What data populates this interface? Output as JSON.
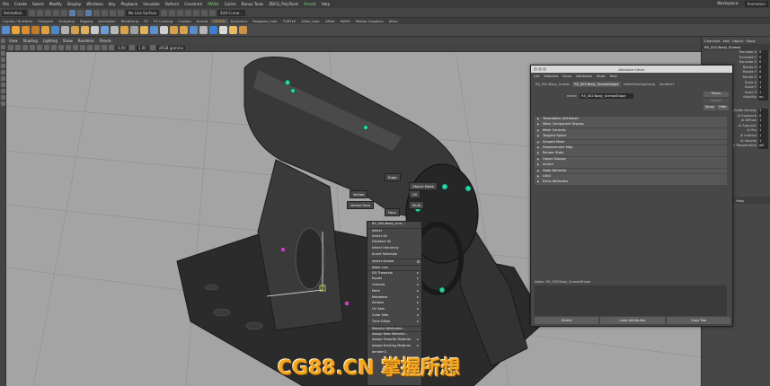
{
  "menubar": {
    "items": [
      "File",
      "Create",
      "Select",
      "Modify",
      "Display",
      "Windows",
      "Key",
      "Playback",
      "Visualize",
      "Deform",
      "Constrain",
      "MASH",
      "Cache",
      "Bonus Tools",
      "ZBCG_PolyTools",
      "Arnold",
      "Help"
    ],
    "workspace_label": "Workspace:",
    "workspace_value": "Animation"
  },
  "statusline": {
    "mode": "Animation",
    "no_live_surface": "No Live Surface",
    "edit_mode": "Edit Curve..."
  },
  "shelf": {
    "tabs": [
      "Curves / Surfaces",
      "Polygons",
      "Sculpting",
      "Rigging",
      "Animation",
      "Rendering",
      "FX",
      "FX Caching",
      "Custom",
      "Arnold",
      "GESDN",
      "Dynamics",
      "Polygons_User",
      "TURTLE",
      "XGen_User",
      "XMod",
      "MASH",
      "Motion Graphics",
      "XGen"
    ],
    "active_tab": "GESDN"
  },
  "viewport": {
    "menu": [
      "View",
      "Shading",
      "Lighting",
      "Show",
      "Renderer",
      "Panels"
    ],
    "field_a": "0.00",
    "field_b": "1.00",
    "colorspace": "sRGB gamma"
  },
  "marking_menu": {
    "north": "Edge",
    "northeast": "Object Mode",
    "west": "Vertex",
    "east": "UV",
    "southwest": "Vertex Face",
    "southeast": "Multi",
    "south": "Face"
  },
  "context_menu": {
    "header": "RS_002:Body_Scre...",
    "items": [
      {
        "label": "Select",
        "sep": true
      },
      {
        "label": "Select All",
        "sep": false
      },
      {
        "label": "Deselect All",
        "sep": false
      },
      {
        "label": "Select Hierarchy",
        "sep": false
      },
      {
        "label": "Invert Selection",
        "sep": false
      },
      {
        "label": "Select Similar",
        "sep": true,
        "box": true
      },
      {
        "label": "Make Live",
        "sep": true
      },
      {
        "label": "DG Traversal",
        "sep": true,
        "arrow": true
      },
      {
        "label": "Inputs",
        "sep": false,
        "arrow": true
      },
      {
        "label": "Outputs",
        "sep": false,
        "arrow": true
      },
      {
        "label": "Paint",
        "sep": false,
        "arrow": true
      },
      {
        "label": "Metadata",
        "sep": false,
        "arrow": true
      },
      {
        "label": "Actions",
        "sep": false,
        "arrow": true
      },
      {
        "label": "UV Sets",
        "sep": false,
        "arrow": true
      },
      {
        "label": "Color Sets",
        "sep": false,
        "arrow": true
      },
      {
        "label": "Time Editor",
        "sep": false,
        "arrow": true
      },
      {
        "label": "Material Attributes...",
        "sep": true
      },
      {
        "label": "Assign New Material...",
        "sep": true
      },
      {
        "label": "Assign Favorite Material",
        "sep": false,
        "arrow": true
      },
      {
        "label": "Assign Existing Material",
        "sep": false,
        "arrow": true
      },
      {
        "label": "lambert1",
        "sep": false
      }
    ]
  },
  "channel_box": {
    "menu": [
      "Channels",
      "Edit",
      "Object",
      "Show"
    ],
    "object_name": "RS_002:Body_Screws",
    "attributes": [
      {
        "name": "Translate X",
        "value": "0"
      },
      {
        "name": "Translate Y",
        "value": "0"
      },
      {
        "name": "Translate Z",
        "value": "0"
      },
      {
        "name": "Rotate X",
        "value": "0"
      },
      {
        "name": "Rotate Y",
        "value": "0"
      },
      {
        "name": "Rotate Z",
        "value": "0"
      },
      {
        "name": "Scale X",
        "value": "1"
      },
      {
        "name": "Scale Y",
        "value": "1"
      },
      {
        "name": "Scale Z",
        "value": "1"
      },
      {
        "name": "Visibility",
        "value": "on"
      }
    ],
    "shape_section": "...ScrewsShape",
    "shape_attributes": [
      {
        "name": "Visible Density",
        "value": "1"
      },
      {
        "name": "Ai Exposure",
        "value": "0"
      },
      {
        "name": "Ai Diffuse",
        "value": "1"
      },
      {
        "name": "Ai Specular",
        "value": "1"
      },
      {
        "name": "Ai Sss",
        "value": "1"
      },
      {
        "name": "Ai Indirect",
        "value": "1"
      },
      {
        "name": "Ai Volume",
        "value": "1"
      },
      {
        "name": "Ai Temperature",
        "value": "off"
      }
    ],
    "lower_menu": [
      "Layers",
      "Options",
      "Help"
    ]
  },
  "attribute_editor": {
    "title": "Attribute Editor",
    "menu": [
      "List",
      "Selected",
      "Focus",
      "Attributes",
      "Show",
      "Help"
    ],
    "tabs": [
      "RS_002:Body_Screws",
      "RS_002:Body_ScrewsShape",
      "initialShadingGroup",
      "lambert1"
    ],
    "active_tab": "RS_002:Body_ScrewsShape",
    "mesh_label": "mesh:",
    "mesh_value": "RS_002:Body_ScrewsShape",
    "focus_btn": "Focus",
    "presets_btn": "Presets",
    "show_btn": "Show",
    "hide_btn": "Hide",
    "sections": [
      "Tessellation Attributes",
      "Mesh Component Display",
      "Mesh Controls",
      "Tangent Space",
      "Smooth Mesh",
      "Displacement Map",
      "Render Stats",
      "Object Display",
      "Arnold",
      "Node Behavior",
      "UUID",
      "Extra Attributes"
    ],
    "notes_label": "Notes: RS_002:Body_ScrewsShape",
    "buttons": [
      "Select",
      "Load Attributes",
      "Copy Tab"
    ]
  },
  "watermark": "CG88.CN 掌握所想"
}
